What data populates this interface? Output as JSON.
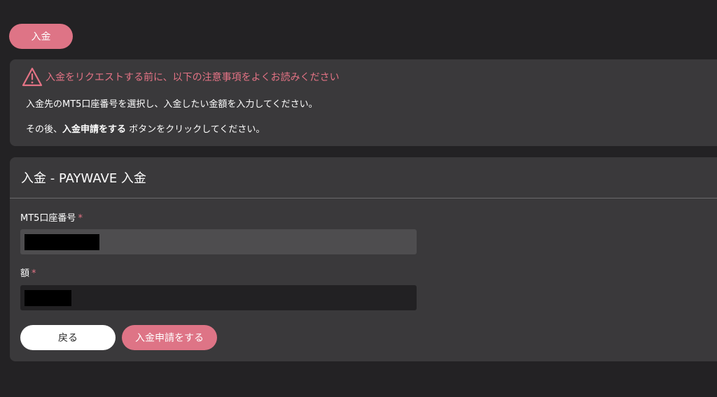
{
  "tab": {
    "label": "入金"
  },
  "notice": {
    "title": "入金をリクエストする前に、以下の注意事項をよくお読みください",
    "line1": "入金先のMT5口座番号を選択し、入金したい金額を入力してください。",
    "line2_prefix": "その後、",
    "line2_bold": "入金申請をする",
    "line2_suffix": " ボタンをクリックしてください。"
  },
  "form": {
    "title": "入金 - PAYWAVE 入金",
    "account_label": "MT5口座番号",
    "amount_label": "額",
    "required_mark": "*",
    "back_label": "戻る",
    "submit_label": "入金申請をする"
  },
  "colors": {
    "accent": "#de7486",
    "warning_text": "#e47385",
    "background": "#232224",
    "card": "#3a393b"
  },
  "icons": {
    "warning": "warning-triangle-icon"
  }
}
